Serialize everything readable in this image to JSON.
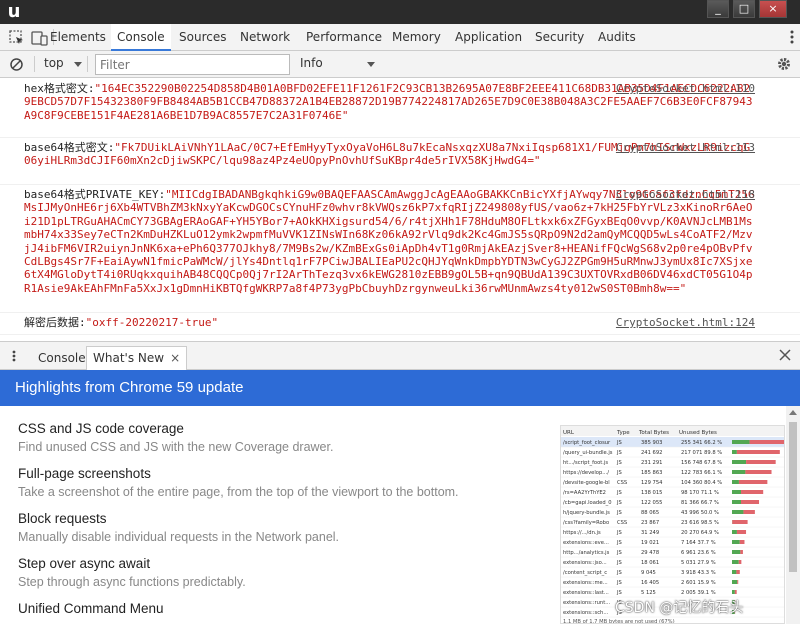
{
  "window": {
    "logo": "u",
    "minimize": "_",
    "maximize": "□",
    "close": "×"
  },
  "tabs": [
    "Elements",
    "Console",
    "Sources",
    "Network",
    "Performance",
    "Memory",
    "Application",
    "Security",
    "Audits"
  ],
  "active_tab": "Console",
  "console_toolbar": {
    "context": "top",
    "filter_placeholder": "Filter",
    "level": "Info"
  },
  "messages": [
    {
      "label": "hex格式密文:",
      "value": "\"164EC352290B02254D858D4B01A0BFD02EFE11F1261F2C93CB13B2695A07E8BF2EEE411C68DB31AB35D4F1AECDC6222AB29EBCD57D7F15432380F9FB8484AB5B1CCB47D88372A1B4EB28872D19B774224817AD265E7D9C0E38B048A3C2FE5AAEF7C6B3E0FCF87943A9C8F9CEBE151F4AE281A6BE1D7B9AC8557E7C2A31F0746E\"",
      "source": "CryptoSocket.html:110"
    },
    {
      "label": "base64格式密文:",
      "value": "\"Fk7DUikLAiVNhY1LAaC/0C7+EfEmHyyTyxOyaVoH6L8u7kEcaNsxqzXU8a7NxiIqsp681X1/FUMjgPn7hISrWxzLR9izcqG06yiHLRm3dCJIF60mXn2cDjiwSKPC/lqu98az4Pz4eUOpyPnOvhUfSuKBpr4de5rIVX58KjHwdG4=\"",
      "source": "CryptoSocket.html:113"
    },
    {
      "label": "base64格式PRIVATE_KEY:",
      "value": "\"MIICdgIBADANBgkqhkiG9w0BAQEFAASCAmAwggJcAgEAAoGBAKKCnBicYXfjAYwqy7N3lo9GCaf3fdznCg5mT25GMsIJMyOnHE6rj6Xb4WTVBhZM3kNxyYaKcwDGOCsCYnuHFz0whvr8kVWQsz6kP7xfqRIjZ249808yfUS/vao6z+7kH25FbYrVLz3xKinoRr6AeOi21D1pLTRGuAHACmCY73GBAgERAoGAF+YH5YBor7+AOkKHXigsurd54/6/r4tjXHh1F78HduM8OFLtkxk6xZFGyxBEqO0vvp/K0AVNJcLMB1MsmbH74x33Sey7eCTn2KmDuHZKLuO12ymk2wpmfMuVVK1ZINsWIn68Kz06kA92rVlq9dk2Kc4GmJS5sQRpO9N2d2amQyMCQQD5wLs4CoATF2/MzvjJ4ibFM6VIR2uiynJnNK6xa+ePh6Q377OJkhy8/7M9Bs2w/KZmBExGs0iApDh4vT1g0RmjAkEAzjSver8+HEANifFQcWgS68v2p0re4pOBvPfvCdLBgs4Sr7F+EaiAywN1fmicPaWMcW/jlYs4Dntlq1rF7PCiwJBALIEaPU2cQHJYqWnkDmpbYDTN3wCyGJ2ZPGm9H5uRMnwJ3ymUx8Ic7XSjxe6tX4MGloDytT4i0RUqkxquihAB48CQQCp0Qj7rI2ArThTezq3vx6kEWG2810zEBB9gOL5B+qn9QBUdA139C3UXTOVRxdB06DV46xdCT05G1O4pR1Asie9AkEAhFMnFa5XxJx1gDmnHiKBTQfgWKRP7a8f4P73ygPbCbuyhDzrgynweuLki36rwMUnmAwzs4ty012wS0ST0Bmh8w==\"",
      "source": "CryptoSocket.html:118"
    },
    {
      "label": "解密后数据:",
      "value": "\"oxff-20220217-true\"",
      "source": "CryptoSocket.html:124"
    }
  ],
  "drawer": {
    "tabs": [
      "Console",
      "What's New"
    ],
    "active_tab": "What's New",
    "close_glyph": "×"
  },
  "whats_new": {
    "banner": "Highlights from Chrome 59 update",
    "items": [
      {
        "title": "CSS and JS code coverage",
        "desc": "Find unused CSS and JS with the new Coverage drawer."
      },
      {
        "title": "Full-page screenshots",
        "desc": "Take a screenshot of the entire page, from the top of the viewport to the bottom."
      },
      {
        "title": "Block requests",
        "desc": "Manually disable individual requests in the Network panel."
      },
      {
        "title": "Step over async await",
        "desc": "Step through async functions predictably."
      },
      {
        "title": "Unified Command Menu",
        "desc": ""
      }
    ]
  },
  "coverage_preview": {
    "headers": [
      "URL",
      "Type",
      "Total Bytes",
      "Unused Bytes"
    ],
    "rows": [
      [
        "/script_foot_closur",
        "JS",
        "385 903",
        "255 341",
        "66.2 %",
        0.662
      ],
      [
        "/query_ui-bundle.js",
        "JS",
        "241 692",
        "217 071",
        "89.8 %",
        0.898
      ],
      [
        "ht.../script_foot.js",
        "JS",
        "231 291",
        "156 748",
        "67.8 %",
        0.678
      ],
      [
        "https://develop.../",
        "JS",
        "185 863",
        "122 783",
        "66.1 %",
        0.661
      ],
      [
        "/devsite-google-bl",
        "CSS",
        "129 754",
        "104 360",
        "80.4 %",
        0.804
      ],
      [
        "/rs=AA2YrThYE2",
        "JS",
        "138 015",
        "98 170",
        "71.1 %",
        0.711
      ],
      [
        "/cb=gapi.loaded_0",
        "JS",
        "122 055",
        "81 366",
        "66.7 %",
        0.667
      ],
      [
        "h/jquery-bundle.js",
        "JS",
        "88 065",
        "43 996",
        "50.0 %",
        0.5
      ],
      [
        "/css?family=Robo",
        "CSS",
        "23 867",
        "23 616",
        "98.5 %",
        0.985
      ],
      [
        "https://.../dn.js",
        "JS",
        "31 249",
        "20 270",
        "64.9 %",
        0.649
      ],
      [
        "extensions::eve...",
        "JS",
        "19 021",
        "7 164",
        "37.7 %",
        0.377
      ],
      [
        "http.../analytics.js",
        "JS",
        "29 478",
        "6 961",
        "23.6 %",
        0.236
      ],
      [
        "extensions::jso...",
        "JS",
        "18 061",
        "5 031",
        "27.9 %",
        0.279
      ],
      [
        "/content_script_c",
        "JS",
        "9 045",
        "3 918",
        "43.3 %",
        0.433
      ],
      [
        "extensions::me...",
        "JS",
        "16 405",
        "2 601",
        "15.9 %",
        0.159
      ],
      [
        "extensions::last...",
        "JS",
        "5 125",
        "2 005",
        "39.1 %",
        0.391
      ],
      [
        "extensions::runt...",
        "JS",
        "",
        "",
        "",
        0.1
      ],
      [
        "extensions::sch...",
        "JS",
        "",
        "",
        "",
        0.1
      ]
    ],
    "footer": "1.1 MB of 1.7 MB bytes are not used (67%)"
  },
  "watermark": "CSDN @记忆的石头",
  "colors": {
    "accent": "#3879d9",
    "banner": "#2d6bd6",
    "string": "#c41a16"
  }
}
